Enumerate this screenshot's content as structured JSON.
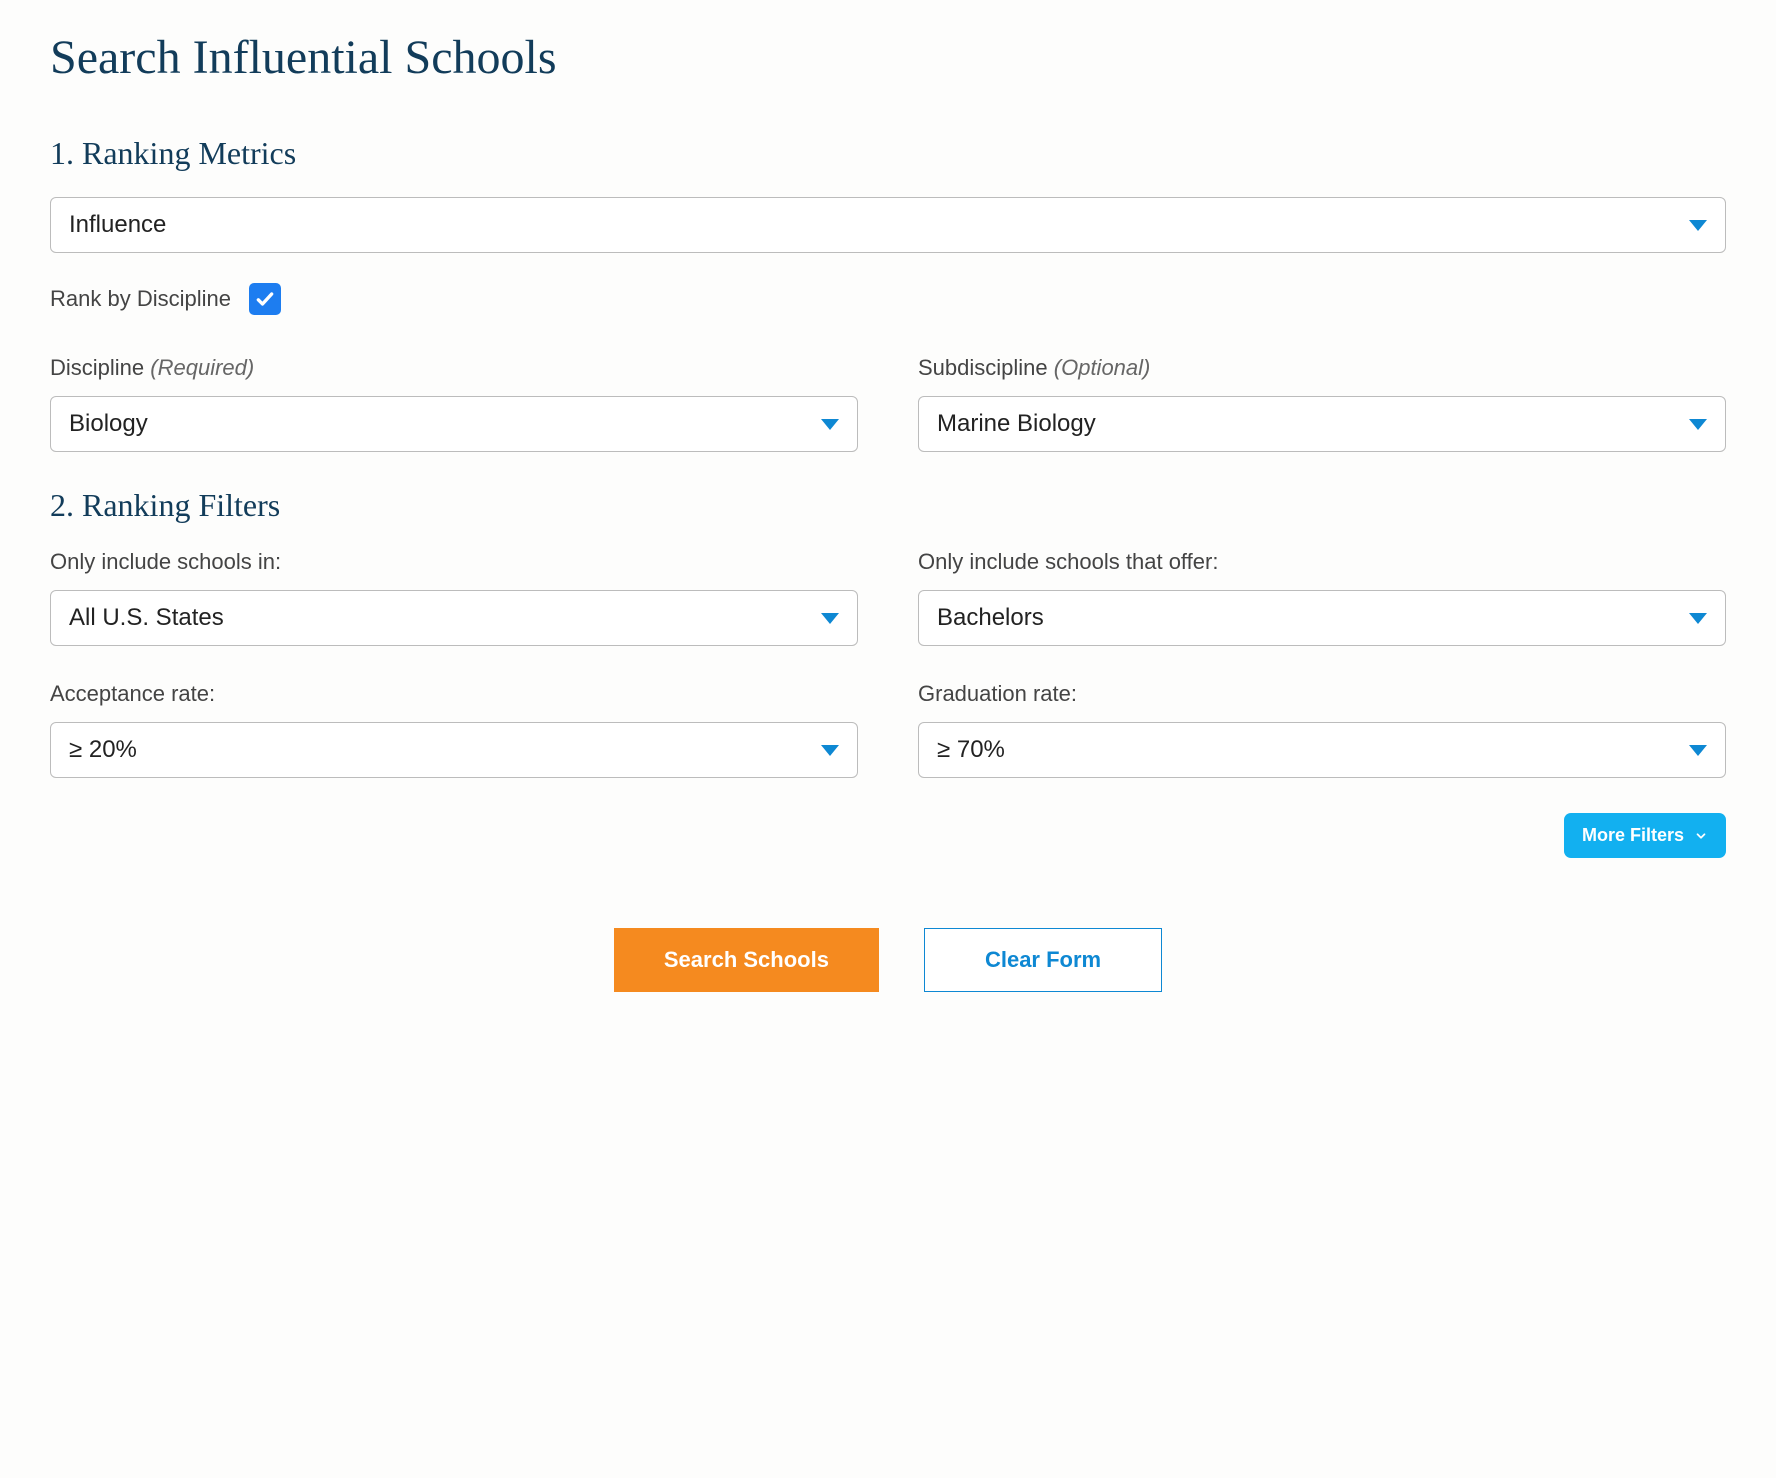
{
  "page_title": "Search Influential Schools",
  "section1": {
    "heading": "1. Ranking Metrics",
    "ranking_metric_value": "Influence",
    "rank_by_discipline_label": "Rank by Discipline",
    "rank_by_discipline_checked": true,
    "discipline": {
      "label": "Discipline",
      "qualifier": "(Required)",
      "value": "Biology"
    },
    "subdiscipline": {
      "label": "Subdiscipline",
      "qualifier": "(Optional)",
      "value": "Marine Biology"
    }
  },
  "section2": {
    "heading": "2. Ranking Filters",
    "include_schools_in": {
      "label": "Only include schools in:",
      "value": "All U.S. States"
    },
    "include_schools_offer": {
      "label": "Only include schools that offer:",
      "value": "Bachelors"
    },
    "acceptance_rate": {
      "label": "Acceptance rate:",
      "value": "≥ 20%"
    },
    "graduation_rate": {
      "label": "Graduation rate:",
      "value": "≥ 70%"
    },
    "more_filters_label": "More Filters"
  },
  "actions": {
    "search_label": "Search Schools",
    "clear_label": "Clear Form"
  }
}
